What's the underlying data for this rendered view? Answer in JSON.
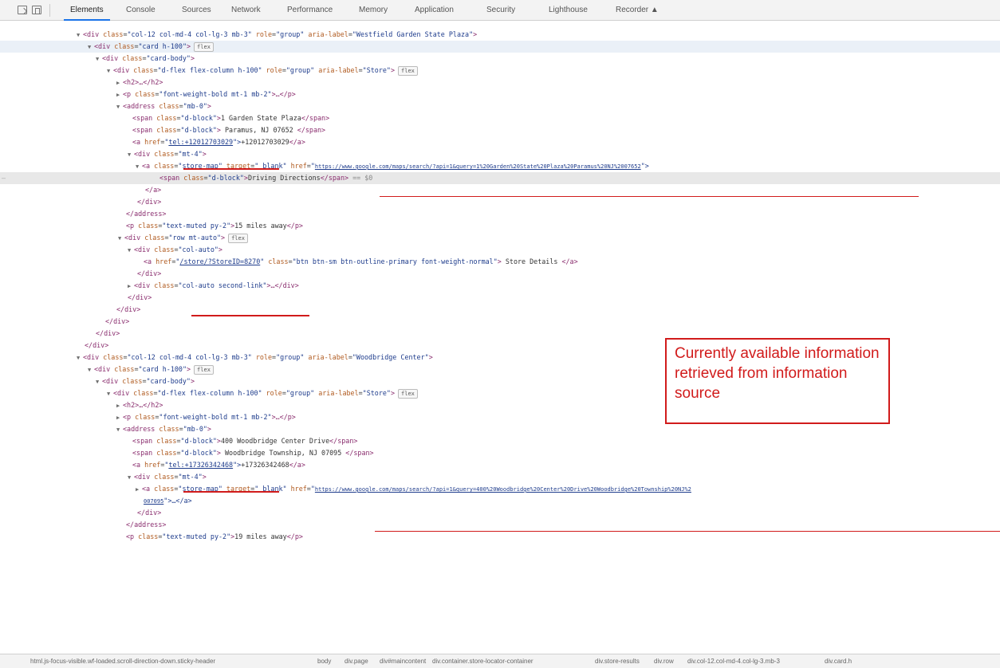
{
  "toolbar": {
    "tabs": [
      "Elements",
      "Console",
      "Sources",
      "Network",
      "Performance",
      "Memory",
      "Application",
      "Security",
      "Lighthouse",
      "Recorder"
    ],
    "recorder_icon": "flask-icon"
  },
  "callout": {
    "text": "Currently available information retrieved from information source",
    "color": "#d11b1b"
  },
  "tree": {
    "l0": {
      "tag": "<div",
      "a1": "class",
      "v1": "\"col-12 col-md-4 col-lg-3 mb-3\"",
      "a2": "role",
      "v2": "\"group\"",
      "a3": "aria-label",
      "v3": "\"Westfield Garden State Plaza\"",
      "end": ">"
    },
    "l1": {
      "tag": "<div",
      "a1": "class",
      "v1": "\"card h-100\"",
      "end": ">",
      "badge": "flex"
    },
    "l2": {
      "tag": "<div",
      "a1": "class",
      "v1": "\"card-body\"",
      "end": ">"
    },
    "l3": {
      "tag": "<div",
      "a1": "class",
      "v1": "\"d-flex flex-column h-100\"",
      "a2": "role",
      "v2": "\"group\"",
      "a3": "aria-label",
      "v3": "\"Store\"",
      "end": ">",
      "badge": "flex"
    },
    "l4": {
      "text": "<h2>…</h2>"
    },
    "l5": {
      "tag": "<p",
      "a1": "class",
      "v1": "\"font-weight-bold mt-1 mb-2\"",
      "end": ">…</p>"
    },
    "l6": {
      "tag": "<address",
      "a1": "class",
      "v1": "\"mb-0\"",
      "end": ">"
    },
    "l7": {
      "tag": "<span",
      "a1": "class",
      "v1": "\"d-block\"",
      "end": ">",
      "text": "1 Garden State Plaza",
      "close": "</span>"
    },
    "l8": {
      "tag": "<span",
      "a1": "class",
      "v1": "\"d-block\"",
      "end": ">",
      "text": " Paramus, NJ 07652 ",
      "close": "</span>"
    },
    "l9": {
      "tag": "<a",
      "a1": "href",
      "q": "\"",
      "link": "tel:+12012703029",
      "end": "\">",
      "text": "+12012703029",
      "close": "</a>"
    },
    "l10": {
      "tag": "<div",
      "a1": "class",
      "v1": "\"mt-4\"",
      "end": ">"
    },
    "l11": {
      "tag": "<a",
      "a1": "class",
      "v1": "\"store-map\"",
      "a2": "target",
      "v2": "\"_blank\"",
      "a3": "href",
      "link": "https://www.google.com/maps/search/?api=1&query=1%20Garden%20State%20Plaza%20Paramus%20NJ%2007652",
      "end": "\">"
    },
    "l12": {
      "tag": "<span",
      "a1": "class",
      "v1": "\"d-block\"",
      "end": ">",
      "text": "Driving Directions",
      "close": "</span>",
      "eq": " == $0"
    },
    "l13": {
      "text": "</a>"
    },
    "l14": {
      "text": "</div>"
    },
    "l15": {
      "text": "</address>"
    },
    "l16": {
      "tag": "<p",
      "a1": "class",
      "v1": "\"text-muted py-2\"",
      "end": ">",
      "text": "15 miles away",
      "close": "</p>"
    },
    "l17": {
      "tag": "<div",
      "a1": "class",
      "v1": "\"row mt-auto\"",
      "end": ">",
      "badge": "flex"
    },
    "l18": {
      "tag": "<div",
      "a1": "class",
      "v1": "\"col-auto\"",
      "end": ">"
    },
    "l19": {
      "tag": "<a",
      "a1": "href",
      "q": "\"",
      "link": "/store/?StoreID=8270",
      "end": "\"",
      "a2": " class",
      "v2": "\"btn btn-sm btn-outline-primary font-weight-normal\"",
      "end2": ">",
      "text": " Store Details ",
      "close": "</a>"
    },
    "l20": {
      "text": "</div>"
    },
    "l21": {
      "tag": "<div",
      "a1": "class",
      "v1": "\"col-auto second-link\"",
      "end": ">…</div>"
    },
    "l22": {
      "text": "</div>"
    },
    "l23": {
      "text": "</div>"
    },
    "l24": {
      "text": "</div>"
    },
    "l25": {
      "text": "</div>"
    },
    "l26": {
      "text": "</div>"
    },
    "l27": {
      "tag": "<div",
      "a1": "class",
      "v1": "\"col-12 col-md-4 col-lg-3 mb-3\"",
      "a2": "role",
      "v2": "\"group\"",
      "a3": "aria-label",
      "v3": "\"Woodbridge Center\"",
      "end": ">"
    },
    "l28": {
      "tag": "<div",
      "a1": "class",
      "v1": "\"card h-100\"",
      "end": ">",
      "badge": "flex"
    },
    "l29": {
      "tag": "<div",
      "a1": "class",
      "v1": "\"card-body\"",
      "end": ">"
    },
    "l30": {
      "tag": "<div",
      "a1": "class",
      "v1": "\"d-flex flex-column h-100\"",
      "a2": "role",
      "v2": "\"group\"",
      "a3": "aria-label",
      "v3": "\"Store\"",
      "end": ">",
      "badge": "flex"
    },
    "l31": {
      "text": "<h2>…</h2>"
    },
    "l32": {
      "tag": "<p",
      "a1": "class",
      "v1": "\"font-weight-bold mt-1 mb-2\"",
      "end": ">…</p>"
    },
    "l33": {
      "tag": "<address",
      "a1": "class",
      "v1": "\"mb-0\"",
      "end": ">"
    },
    "l34": {
      "tag": "<span",
      "a1": "class",
      "v1": "\"d-block\"",
      "end": ">",
      "text": "400 Woodbridge Center Drive",
      "close": "</span>"
    },
    "l35": {
      "tag": "<span",
      "a1": "class",
      "v1": "\"d-block\"",
      "end": ">",
      "text": " Woodbridge Township, NJ 07095 ",
      "close": "</span>"
    },
    "l36": {
      "tag": "<a",
      "a1": "href",
      "q": "\"",
      "link": "tel:+17326342468",
      "end": "\">",
      "text": "+17326342468",
      "close": "</a>"
    },
    "l37": {
      "tag": "<div",
      "a1": "class",
      "v1": "\"mt-4\"",
      "end": ">"
    },
    "l38": {
      "tag": "<a",
      "a1": "class",
      "v1": "\"store-map\"",
      "a2": "target",
      "v2": "\"_blank\"",
      "a3": "href",
      "link": "https://www.google.com/maps/search/?api=1&query=400%20Woodbridge%20Center%20Drive%20Woodbridge%20Township%20NJ%2",
      "end": ""
    },
    "l39": {
      "link": "007095",
      "end": "\">…</a>"
    },
    "l40": {
      "text": "</div>"
    },
    "l41": {
      "text": "</address>"
    },
    "l42": {
      "tag": "<p",
      "a1": "class",
      "v1": "\"text-muted py-2\"",
      "end": ">",
      "text": "19 miles away",
      "close": "</p>"
    }
  },
  "breadcrumbs": [
    "html.js-focus-visible.wf-loaded.scroll-direction-down.sticky-header",
    "body",
    "div.page",
    "div#maincontent",
    "div.container.store-locator-container",
    "div.store-results",
    "div.row",
    "div.col-12.col-md-4.col-lg-3.mb-3",
    "div.card.h"
  ]
}
